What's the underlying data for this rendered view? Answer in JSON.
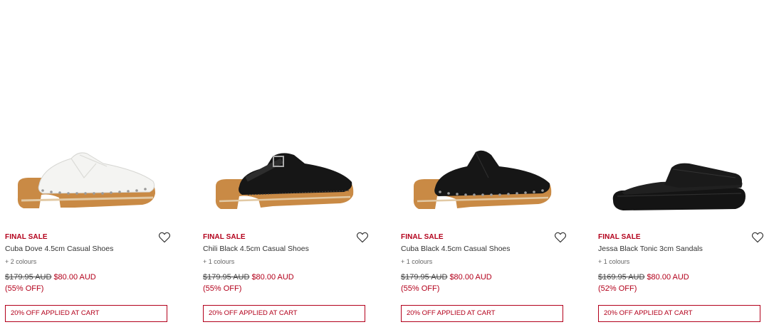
{
  "products": [
    {
      "badge": "FINAL SALE",
      "name": "Cuba Dove 4.5cm Casual Shoes",
      "colours": "+ 2 colours",
      "original_price": "$179.95 AUD",
      "sale_price": "$80.00 AUD",
      "discount": "(55% OFF)",
      "promo": "20% OFF APPLIED AT CART",
      "shoe_color": "white"
    },
    {
      "badge": "FINAL SALE",
      "name": "Chili Black 4.5cm Casual Shoes",
      "colours": "+ 1 colours",
      "original_price": "$179.95 AUD",
      "sale_price": "$80.00 AUD",
      "discount": "(55% OFF)",
      "promo": "20% OFF APPLIED AT CART",
      "shoe_color": "black"
    },
    {
      "badge": "FINAL SALE",
      "name": "Cuba Black 4.5cm Casual Shoes",
      "colours": "+ 1 colours",
      "original_price": "$179.95 AUD",
      "sale_price": "$80.00 AUD",
      "discount": "(55% OFF)",
      "promo": "20% OFF APPLIED AT CART",
      "shoe_color": "black"
    },
    {
      "badge": "FINAL SALE",
      "name": "Jessa Black Tonic 3cm Sandals",
      "colours": "+ 1 colours",
      "original_price": "$169.95 AUD",
      "sale_price": "$80.00 AUD",
      "discount": "(52% OFF)",
      "promo": "20% OFF APPLIED AT CART",
      "shoe_color": "black"
    }
  ],
  "colors": {
    "sale_red": "#b3001b",
    "wood": "#c98a45",
    "black_leather": "#161616",
    "white_leather": "#f4f4f2"
  },
  "icons": {
    "wishlist": "heart-outline-icon"
  }
}
